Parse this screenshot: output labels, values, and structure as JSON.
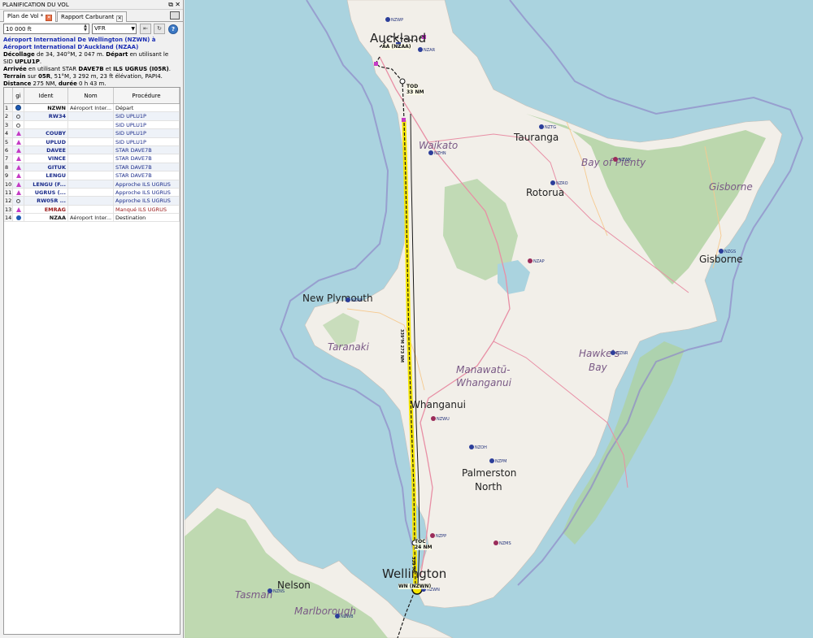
{
  "panel": {
    "title": "PLANIFICATION DU VOL",
    "float_icon": "float-icon",
    "close_icon": "close-icon",
    "tabs": [
      {
        "label": "Plan de Vol *",
        "active": true
      },
      {
        "label": "Rapport Carburant",
        "active": false
      }
    ]
  },
  "controls": {
    "altitude_value": "10 000 ft",
    "flight_rules": "VFR",
    "spin_up_icon": "▲",
    "spin_down_icon": "▼",
    "dropdown_icon": "▼",
    "help_label": "?"
  },
  "summary": {
    "route_title": "Aéroport International De Wellington (NZWN) à Aéroport International D'Auckland (NZAA)",
    "takeoff_label": "Décollage",
    "takeoff_text": " de 34, 340°M, 2 047 m. ",
    "departure_label": "Départ",
    "departure_text": " en utilisant le SID ",
    "sid": "UPLU1P",
    "arrival_label": "Arrivée",
    "arrival_text": " en utilisant STAR ",
    "star": "DAVE7B",
    "and_text": " et ",
    "approach": "ILS UGRUS (I05R)",
    "terrain_label": "Terrain",
    "terrain_text": " sur ",
    "runway": "05R",
    "terrain_detail": ", 51°M, 3 292 m, 23 ft élévation, PAPI4.",
    "distance_label": "Distance",
    "distance_text": " 275 NM, ",
    "duration_label": "durée",
    "duration_text": " 0 h 43 m."
  },
  "table": {
    "headers": [
      "",
      "gi",
      "Ident",
      "Nom",
      "Procédure"
    ],
    "rows": [
      {
        "n": "1",
        "icon": "airport",
        "ident": "NZWN",
        "name": "Aéroport Inter...",
        "proc": "Départ",
        "style": "plain"
      },
      {
        "n": "2",
        "icon": "circle",
        "ident": "RW34",
        "name": "",
        "proc": "SID UPLU1P",
        "style": "alt"
      },
      {
        "n": "3",
        "icon": "circle",
        "ident": "",
        "name": "",
        "proc": "SID UPLU1P",
        "style": ""
      },
      {
        "n": "4",
        "icon": "tri",
        "ident": "COUBY",
        "name": "",
        "proc": "SID UPLU1P",
        "style": "alt"
      },
      {
        "n": "5",
        "icon": "tri",
        "ident": "UPLUD",
        "name": "",
        "proc": "SID UPLU1P",
        "style": ""
      },
      {
        "n": "6",
        "icon": "tri",
        "ident": "DAVEE",
        "name": "",
        "proc": "STAR DAVE7B",
        "style": "alt"
      },
      {
        "n": "7",
        "icon": "tri",
        "ident": "VINCE",
        "name": "",
        "proc": "STAR DAVE7B",
        "style": ""
      },
      {
        "n": "8",
        "icon": "tri",
        "ident": "GITUK",
        "name": "",
        "proc": "STAR DAVE7B",
        "style": "alt"
      },
      {
        "n": "9",
        "icon": "tri",
        "ident": "LENGU",
        "name": "",
        "proc": "STAR DAVE7B",
        "style": ""
      },
      {
        "n": "10",
        "icon": "tri",
        "ident": "LENGU (F...",
        "name": "",
        "proc": "Approche ILS UGRUS",
        "style": "alt"
      },
      {
        "n": "11",
        "icon": "tri",
        "ident": "UGRUS (...",
        "name": "",
        "proc": "Approche ILS UGRUS",
        "style": ""
      },
      {
        "n": "12",
        "icon": "circle",
        "ident": "RW05R ...",
        "name": "",
        "proc": "Approche ILS UGRUS",
        "style": "alt"
      },
      {
        "n": "13",
        "icon": "tri",
        "ident": "EMRAG",
        "name": "",
        "proc": "Manqué ILS UGRUS",
        "style": "miss"
      },
      {
        "n": "14",
        "icon": "diamond",
        "ident": "NZAA",
        "name": "Aéroport Inter...",
        "proc": "Destination",
        "style": "plain"
      }
    ]
  },
  "map": {
    "places": [
      {
        "label": "Auckland",
        "cls": "big"
      },
      {
        "label": "Waikato",
        "cls": "region"
      },
      {
        "label": "Tauranga",
        "cls": "city"
      },
      {
        "label": "Bay of Plenty",
        "cls": "region"
      },
      {
        "label": "Rotorua",
        "cls": "city"
      },
      {
        "label": "Gisborne",
        "cls": "region"
      },
      {
        "label": "Gisborne",
        "cls": "city"
      },
      {
        "label": "New Plymouth",
        "cls": "city"
      },
      {
        "label": "Taranaki",
        "cls": "region"
      },
      {
        "label": "Manawatū-",
        "cls": "region"
      },
      {
        "label": "Whanganui",
        "cls": "region"
      },
      {
        "label": "Hawke's",
        "cls": "region"
      },
      {
        "label": "Bay",
        "cls": "region"
      },
      {
        "label": "Whanganui",
        "cls": "city"
      },
      {
        "label": "Palmerston",
        "cls": "city"
      },
      {
        "label": "North",
        "cls": "city"
      },
      {
        "label": "Wellington",
        "cls": "big"
      },
      {
        "label": "Nelson",
        "cls": "city"
      },
      {
        "label": "Tasman",
        "cls": "region"
      },
      {
        "label": "Marlborough",
        "cls": "region"
      }
    ],
    "airports": [
      {
        "code": "NZWP",
        "mil": false
      },
      {
        "code": "NZAR",
        "mil": false
      },
      {
        "code": "NZTG",
        "mil": false
      },
      {
        "code": "NZHN",
        "mil": false
      },
      {
        "code": "NZWK",
        "mil": true
      },
      {
        "code": "NZRO",
        "mil": false
      },
      {
        "code": "NZGS",
        "mil": false
      },
      {
        "code": "NZAP",
        "mil": true
      },
      {
        "code": "NZNP",
        "mil": false
      },
      {
        "code": "NZNR",
        "mil": false
      },
      {
        "code": "NZWU",
        "mil": true
      },
      {
        "code": "NZOH",
        "mil": false
      },
      {
        "code": "NZPM",
        "mil": false
      },
      {
        "code": "NZPP",
        "mil": true
      },
      {
        "code": "NZMS",
        "mil": true
      },
      {
        "code": "NZNS",
        "mil": false
      },
      {
        "code": "NZWB",
        "mil": false
      },
      {
        "code": "NZWN",
        "mil": false
      }
    ],
    "waypoints": [
      {
        "label": "TOD"
      },
      {
        "label": "33 NM"
      },
      {
        "label": "TOC"
      },
      {
        "label": "24 NM"
      },
      {
        "label": "AA (NZAA)"
      },
      {
        "label": "WN (NZWN)"
      }
    ],
    "leg_labels": [
      {
        "label": "339°M 273 NM"
      },
      {
        "label": "339°M"
      }
    ],
    "colors": {
      "water": "#aad3df",
      "land": "#f2efe9",
      "forest": "#add19e",
      "route": "#1a1a1a",
      "route_highlight": "#f5e600"
    }
  }
}
